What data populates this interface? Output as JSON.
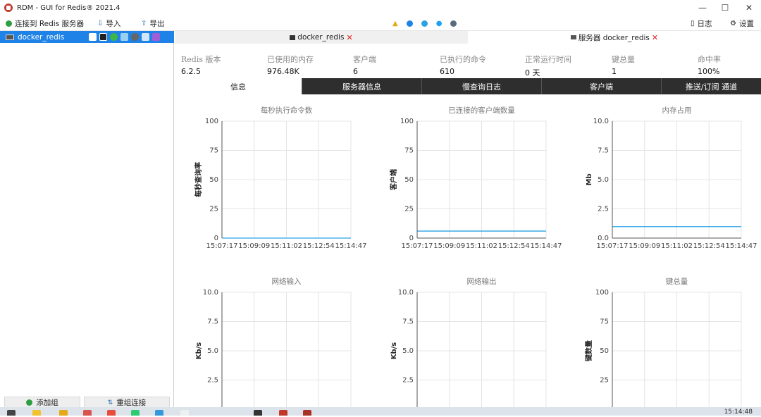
{
  "window": {
    "title": "RDM - GUI for Redis® 2021.4",
    "minimize": "—",
    "maximize": "☐",
    "close": "✕"
  },
  "toolbar": {
    "connect_label": "连接到 Redis 服务器",
    "import_label": "导入",
    "export_label": "导出",
    "log_label": "日志",
    "settings_label": "设置"
  },
  "sidebar": {
    "connection_name": "docker_redis",
    "add_group_label": "添加组",
    "reconnect_label": "重组连接"
  },
  "tabs": [
    {
      "label": "docker_redis",
      "close": "✕"
    },
    {
      "label": "服务器 docker_redis",
      "close": "✕"
    }
  ],
  "stats": [
    {
      "label": "Redis 版本",
      "value": "6.2.5"
    },
    {
      "label": "已使用的内存",
      "value": "976.48K"
    },
    {
      "label": "客户端",
      "value": "6"
    },
    {
      "label": "已执行的命令",
      "value": "610"
    },
    {
      "label": "正常运行时间",
      "value": "0 天"
    },
    {
      "label": "键总量",
      "value": "1"
    },
    {
      "label": "命中率",
      "value": "100%"
    }
  ],
  "subtabs": [
    "信息",
    "服务器信息",
    "慢查询日志",
    "客户端",
    "推送/订阅 通道"
  ],
  "colors": {
    "accent": "#1e82e6",
    "line": "#29a3e6",
    "grid": "#e4e4e4",
    "dark_tab": "#2e2e2e"
  },
  "chart_data": [
    {
      "type": "line",
      "title": "每秒执行命令数",
      "ylabel": "每秒查询率",
      "x": [
        "15:07:17",
        "15:09:09",
        "15:11:02",
        "15:12:54",
        "15:14:47"
      ],
      "yticks": [
        "0",
        "25",
        "50",
        "75",
        "100"
      ],
      "ylim": [
        0,
        100
      ],
      "values": [
        0,
        0,
        0,
        0,
        0
      ]
    },
    {
      "type": "line",
      "title": "已连接的客户端数量",
      "ylabel": "客户端",
      "x": [
        "15:07:17",
        "15:09:09",
        "15:11:02",
        "15:12:54",
        "15:14:47"
      ],
      "yticks": [
        "0",
        "25",
        "50",
        "75",
        "100"
      ],
      "ylim": [
        0,
        100
      ],
      "values": [
        6,
        6,
        6,
        6,
        6
      ]
    },
    {
      "type": "line",
      "title": "内存占用",
      "ylabel": "Mb",
      "x": [
        "15:07:17",
        "15:09:09",
        "15:11:02",
        "15:12:54",
        "15:14:47"
      ],
      "yticks": [
        "0.0",
        "2.5",
        "5.0",
        "7.5",
        "10.0"
      ],
      "ylim": [
        0,
        10
      ],
      "values": [
        0.98,
        0.98,
        0.98,
        0.98,
        0.98
      ]
    },
    {
      "type": "line",
      "title": "网络输入",
      "ylabel": "Kb/s",
      "yticks": [
        "2.5",
        "5.0",
        "7.5",
        "10.0"
      ],
      "ylim": [
        0,
        10
      ],
      "values": []
    },
    {
      "type": "line",
      "title": "网络输出",
      "ylabel": "Kb/s",
      "yticks": [
        "2.5",
        "5.0",
        "7.5",
        "10.0"
      ],
      "ylim": [
        0,
        10
      ],
      "values": []
    },
    {
      "type": "line",
      "title": "键总量",
      "ylabel": "键数量",
      "yticks": [
        "25",
        "50",
        "75",
        "100"
      ],
      "ylim": [
        0,
        100
      ],
      "values": []
    }
  ],
  "taskbar": {
    "clock": "15:14:48"
  }
}
